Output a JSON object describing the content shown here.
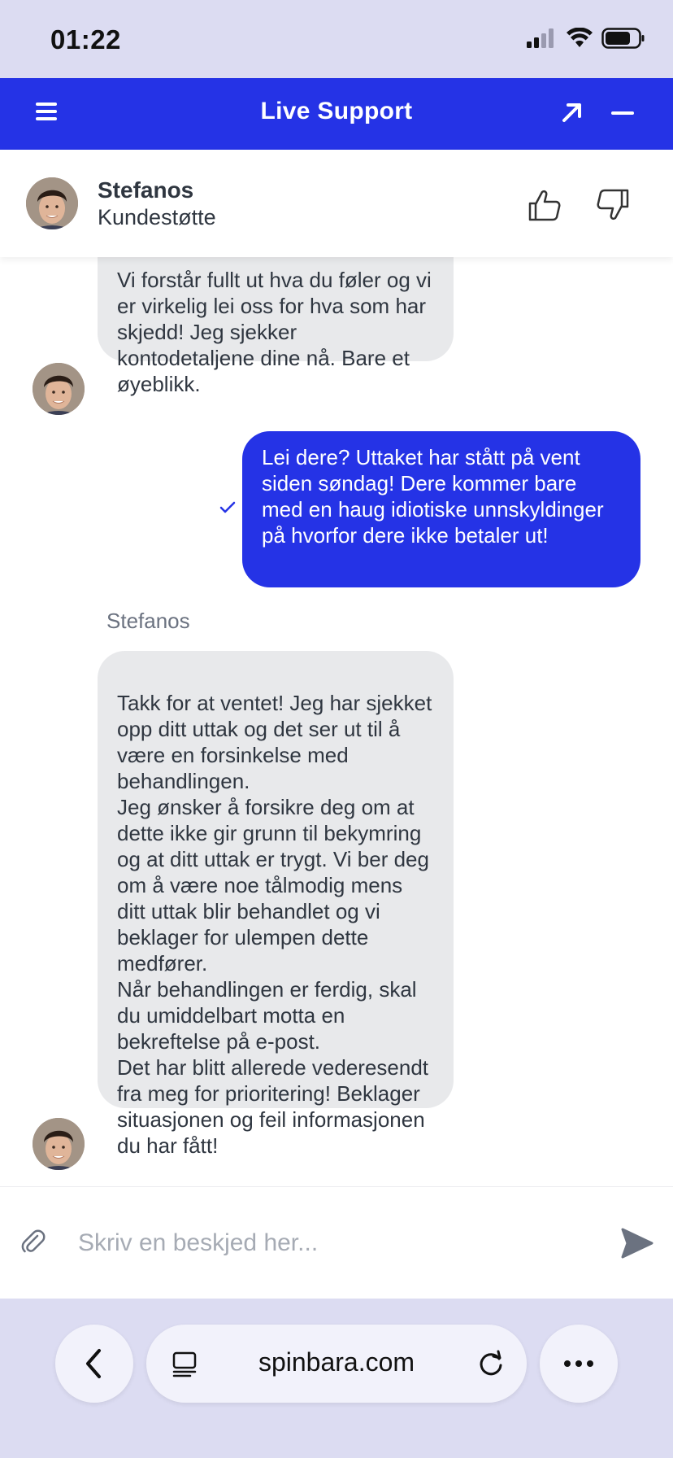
{
  "status_bar": {
    "time": "01:22"
  },
  "header": {
    "title": "Live Support",
    "color": "#2533e6"
  },
  "agent": {
    "name": "Stefanos",
    "role": "Kundestøtte"
  },
  "messages": [
    {
      "direction": "incoming",
      "text": "Vi forstår fullt ut hva du føler og vi er virkelig lei oss for hva som har skjedd! Jeg sjekker kontodetaljene dine nå. Bare et øyeblikk."
    },
    {
      "direction": "outgoing",
      "text": "Lei dere? Uttaket har stått på vent siden søndag! Dere kommer bare med en haug idiotiske unnskyldinger på hvorfor dere ikke betaler ut!"
    },
    {
      "direction": "incoming",
      "sender": "Stefanos",
      "text": "Takk for at ventet! Jeg har sjekket opp ditt uttak og det ser ut til å være en forsinkelse med behandlingen.\nJeg ønsker å forsikre deg om at dette ikke gir grunn til bekymring og at ditt uttak er trygt. Vi ber deg om å være noe tålmodig mens ditt uttak blir behandlet og vi beklager for ulempen dette medfører.\nNår behandlingen er ferdig, skal du umiddelbart motta en bekreftelse på e-post.\nDet har blitt allerede vederesendt fra meg for prioritering! Beklager situasjonen og feil informasjonen du har fått!"
    }
  ],
  "composer": {
    "placeholder": "Skriv en beskjed her..."
  },
  "browser": {
    "url": "spinbara.com"
  }
}
